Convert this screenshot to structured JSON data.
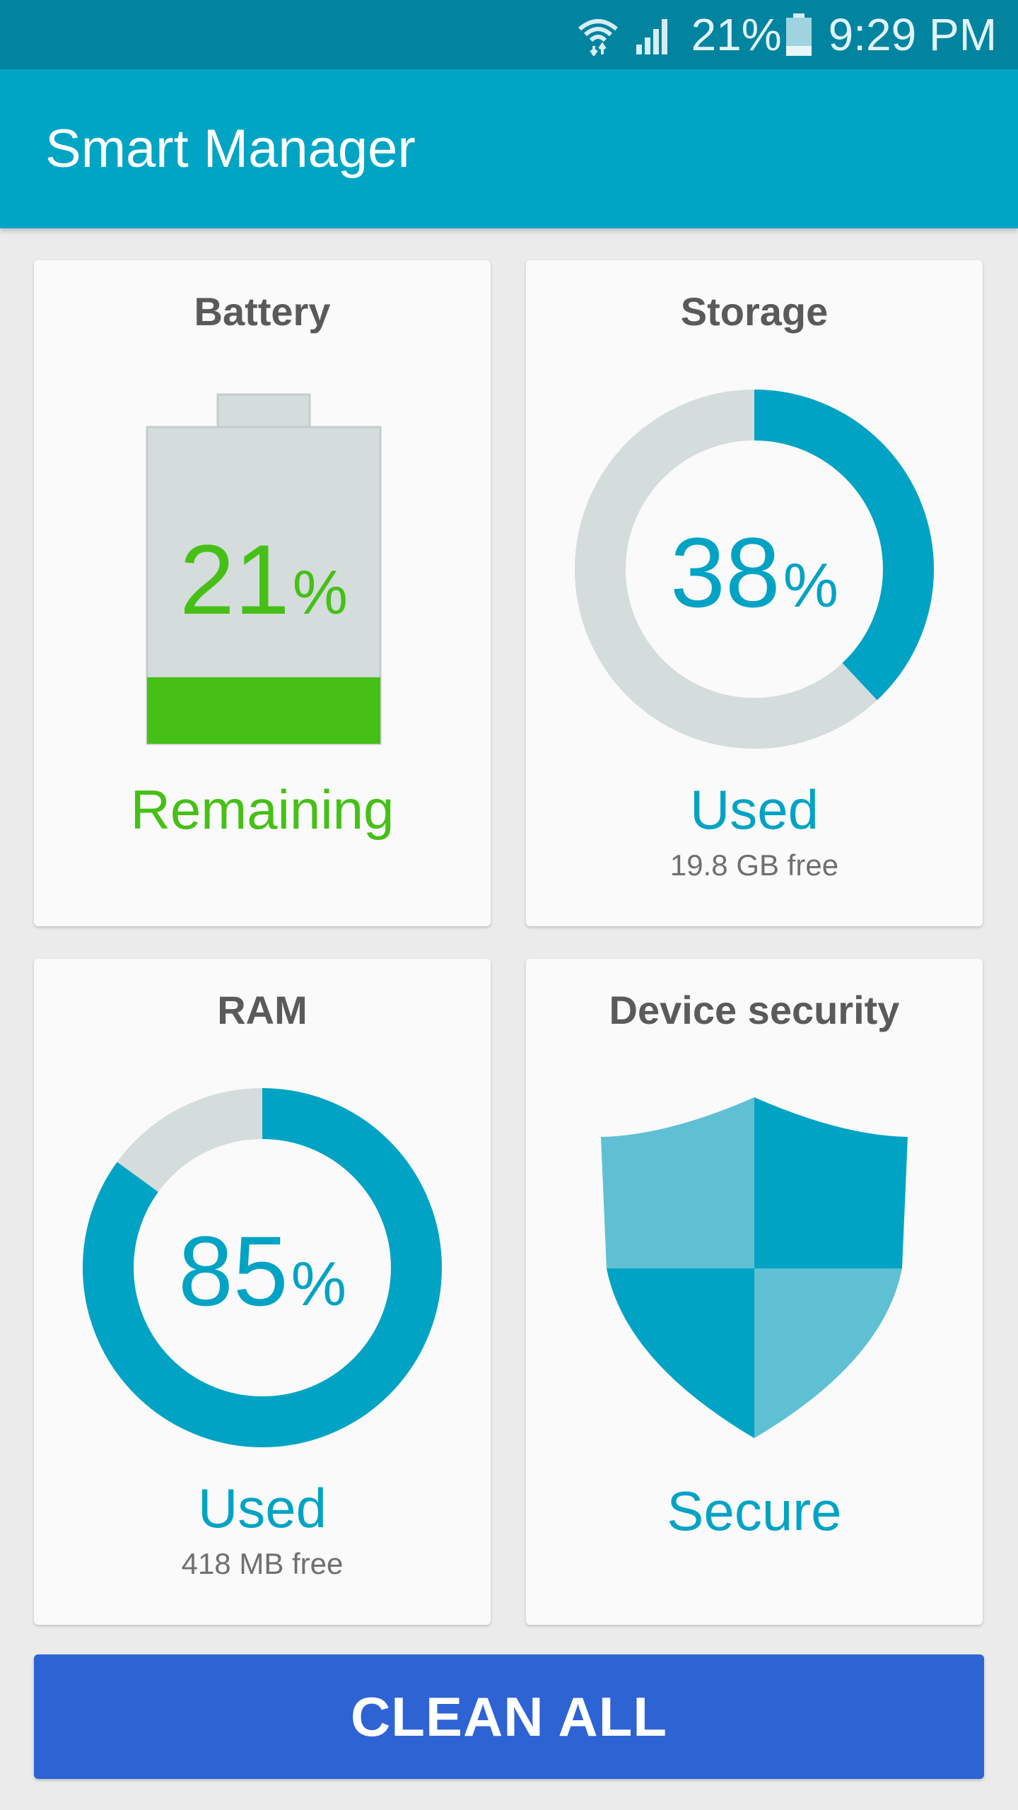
{
  "status_bar": {
    "battery_percent": "21%",
    "time": "9:29 PM",
    "icons": [
      "wifi-icon",
      "signal-icon",
      "battery-icon"
    ]
  },
  "app": {
    "title": "Smart Manager"
  },
  "cards": {
    "battery": {
      "title": "Battery",
      "value": "21",
      "unit": "%",
      "fraction": 0.21,
      "status": "Remaining",
      "color": "#46c016"
    },
    "storage": {
      "title": "Storage",
      "value": "38",
      "unit": "%",
      "fraction": 0.38,
      "status": "Used",
      "detail": "19.8 GB free",
      "color": "#00a3c4"
    },
    "ram": {
      "title": "RAM",
      "value": "85",
      "unit": "%",
      "fraction": 0.85,
      "status": "Used",
      "detail": "418 MB free",
      "color": "#00a3c4"
    },
    "security": {
      "title": "Device security",
      "status": "Secure",
      "icon": "shield-icon",
      "color": "#00a3c4"
    }
  },
  "actions": {
    "clean_all_label": "CLEAN ALL"
  },
  "colors": {
    "status_bar": "#0084a0",
    "app_bar": "#00a5c4",
    "accent": "#00a3c4",
    "battery_green": "#46c016",
    "track_gray": "#d5dcdc",
    "button_blue": "#2e63d4"
  }
}
